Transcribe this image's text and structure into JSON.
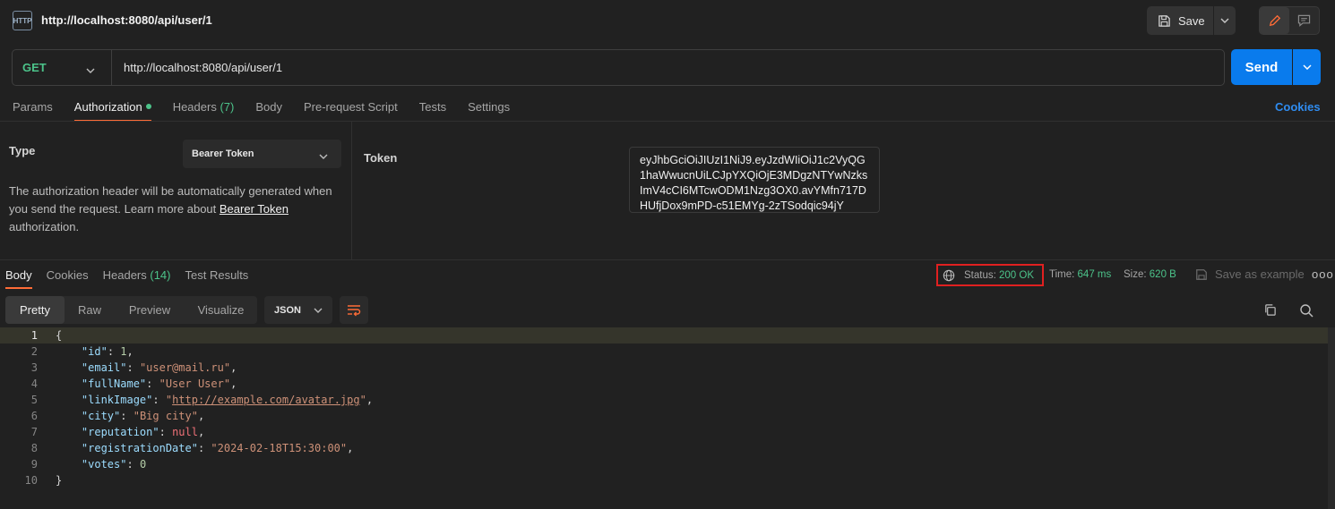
{
  "header": {
    "icon_text": "HTTP",
    "title": "http://localhost:8080/api/user/1",
    "save_label": "Save"
  },
  "request": {
    "method": "GET",
    "url": "http://localhost:8080/api/user/1",
    "send_label": "Send"
  },
  "request_tabs": [
    {
      "label": "Params"
    },
    {
      "label": "Authorization",
      "active": true
    },
    {
      "label": "Headers",
      "count": "(7)"
    },
    {
      "label": "Body"
    },
    {
      "label": "Pre-request Script"
    },
    {
      "label": "Tests"
    },
    {
      "label": "Settings"
    }
  ],
  "cookies_label": "Cookies",
  "auth": {
    "type_label": "Type",
    "type_value": "Bearer Token",
    "desc_1": "The authorization header will be automatically generated when you send the request. Learn more about ",
    "desc_link": "Bearer Token",
    "desc_2": " authorization.",
    "token_label": "Token",
    "token_value": "eyJhbGciOiJIUzI1NiJ9.eyJzdWIiOiJ1c2VyQG1haWwucnUiLCJpYXQiOjE3MDgzNTYwNzksImV4cCI6MTcwODM1Nzg3OX0.avYMfn717DHUfjDox9mPD-c51EMYg-2zTSodqic94jY"
  },
  "response_tabs": [
    {
      "label": "Body",
      "active": true
    },
    {
      "label": "Cookies"
    },
    {
      "label": "Headers",
      "count": "(14)"
    },
    {
      "label": "Test Results"
    }
  ],
  "response_meta": {
    "status_label": "Status:",
    "status_value": "200 OK",
    "time_label": "Time:",
    "time_value": "647 ms",
    "size_label": "Size:",
    "size_value": "620 B",
    "save_example": "Save as example",
    "more": "ooo"
  },
  "format_tabs": [
    "Pretty",
    "Raw",
    "Preview",
    "Visualize"
  ],
  "language": "JSON",
  "code_lines": [
    "1",
    "2",
    "3",
    "4",
    "5",
    "6",
    "7",
    "8",
    "9",
    "10"
  ],
  "code": {
    "open": "{",
    "close": "}",
    "k_id": "\"id\"",
    "v_id": "1",
    "k_email": "\"email\"",
    "v_email": "\"user@mail.ru\"",
    "k_fullName": "\"fullName\"",
    "v_fullName": "\"User User\"",
    "k_linkImage": "\"linkImage\"",
    "v_linkImage": "http://example.com/avatar.jpg",
    "k_city": "\"city\"",
    "v_city": "\"Big city\"",
    "k_reputation": "\"reputation\"",
    "v_reputation": "null",
    "k_registrationDate": "\"registrationDate\"",
    "v_registrationDate": "\"2024-02-18T15:30:00\"",
    "k_votes": "\"votes\"",
    "v_votes": "0"
  },
  "colors": {
    "accent_send": "#097bed",
    "status_ok": "#4cc38a",
    "tab_underline": "#ff6c37",
    "highlight_box": "#e02020"
  }
}
